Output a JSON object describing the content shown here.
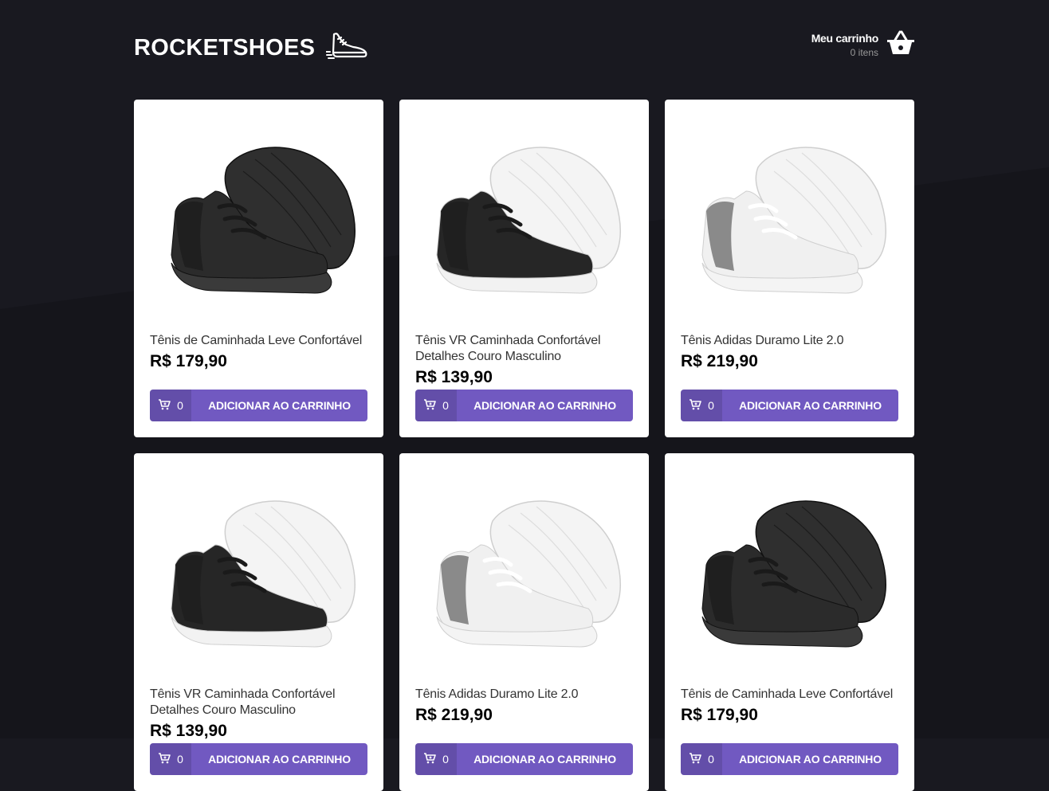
{
  "header": {
    "logo_text": "ROCKETSHOES",
    "cart_title": "Meu carrinho",
    "cart_count": "0 itens"
  },
  "colors": {
    "background": "#191920",
    "accent": "#7159c1"
  },
  "products": [
    {
      "name": "Tênis de Caminhada Leve Confortável",
      "price": "R$ 179,90",
      "amount": "0",
      "button_label": "ADICIONAR AO CARRINHO",
      "shoe_style": "black"
    },
    {
      "name": "Tênis VR Caminhada Confortável Detalhes Couro Masculino",
      "price": "R$ 139,90",
      "amount": "0",
      "button_label": "ADICIONAR AO CARRINHO",
      "shoe_style": "black-white-sole"
    },
    {
      "name": "Tênis Adidas Duramo Lite 2.0",
      "price": "R$ 219,90",
      "amount": "0",
      "button_label": "ADICIONAR AO CARRINHO",
      "shoe_style": "white-grey"
    },
    {
      "name": "Tênis VR Caminhada Confortável Detalhes Couro Masculino",
      "price": "R$ 139,90",
      "amount": "0",
      "button_label": "ADICIONAR AO CARRINHO",
      "shoe_style": "black-white-sole"
    },
    {
      "name": "Tênis Adidas Duramo Lite 2.0",
      "price": "R$ 219,90",
      "amount": "0",
      "button_label": "ADICIONAR AO CARRINHO",
      "shoe_style": "white-grey"
    },
    {
      "name": "Tênis de Caminhada Leve Confortável",
      "price": "R$ 179,90",
      "amount": "0",
      "button_label": "ADICIONAR AO CARRINHO",
      "shoe_style": "black"
    }
  ]
}
